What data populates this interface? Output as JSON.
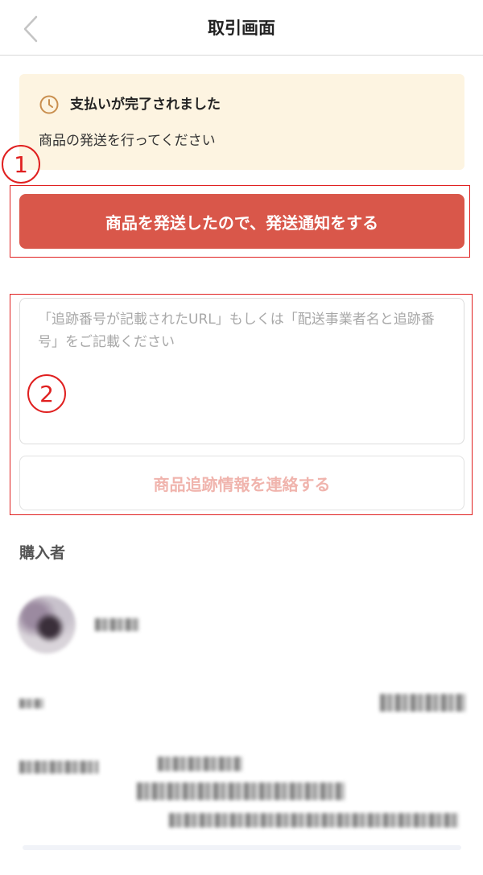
{
  "header": {
    "title": "取引画面",
    "back_icon": "chevron-left-icon"
  },
  "notice": {
    "icon": "clock-icon",
    "title": "支払いが完了されました",
    "message": "商品の発送を行ってください"
  },
  "annotations": {
    "first": "1",
    "second": "2",
    "color": "#e02020"
  },
  "ship": {
    "button_label": "商品を発送したので、発送通知をする",
    "color": "#d9574a"
  },
  "tracking": {
    "placeholder": "「追跡番号が記載されたURL」もしくは「配送事業者名と追跡番号」をご記載ください",
    "value": "",
    "submit_label": "商品追跡情報を連絡する"
  },
  "buyer": {
    "section_title": "購入者"
  },
  "colors": {
    "notice_bg": "#fdf4e1",
    "disabled_text": "#f0b4ad"
  }
}
